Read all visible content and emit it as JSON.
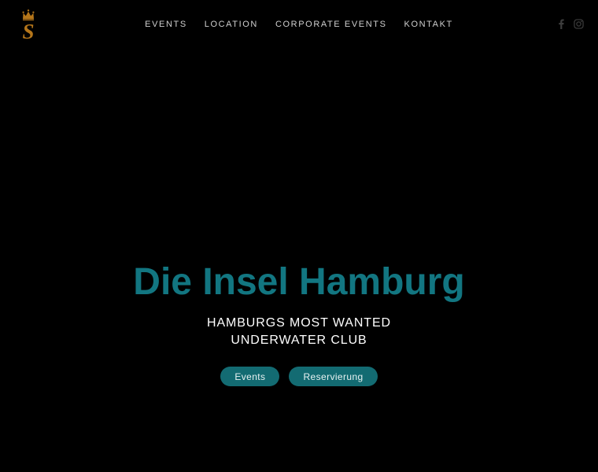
{
  "site": {
    "background_color": "#000000",
    "accent_teal": "#127681",
    "button_teal": "#136b72",
    "logo_gold": "#b5761a"
  },
  "header": {
    "brand": {
      "name": "crown-s-logo",
      "letter": "S",
      "color": "#b5761a"
    },
    "nav_items": [
      {
        "label": "EVENTS",
        "name": "nav-link-events"
      },
      {
        "label": "LOCATION",
        "name": "nav-link-location"
      },
      {
        "label": "CORPORATE EVENTS",
        "name": "nav-link-corporate-events"
      },
      {
        "label": "KONTAKT",
        "name": "nav-link-kontakt"
      }
    ],
    "social": [
      {
        "label": "Facebook",
        "icon": "facebook-icon"
      },
      {
        "label": "Instagram",
        "icon": "instagram-icon"
      }
    ]
  },
  "hero": {
    "title": "Die Insel Hamburg",
    "subtitle_line1": "HAMBURGS MOST WANTED",
    "subtitle_line2": "UNDERWATER CLUB",
    "buttons": [
      {
        "label": "Events",
        "name": "cta-events-button"
      },
      {
        "label": "Reservierung",
        "name": "cta-reservierung-button"
      }
    ]
  }
}
